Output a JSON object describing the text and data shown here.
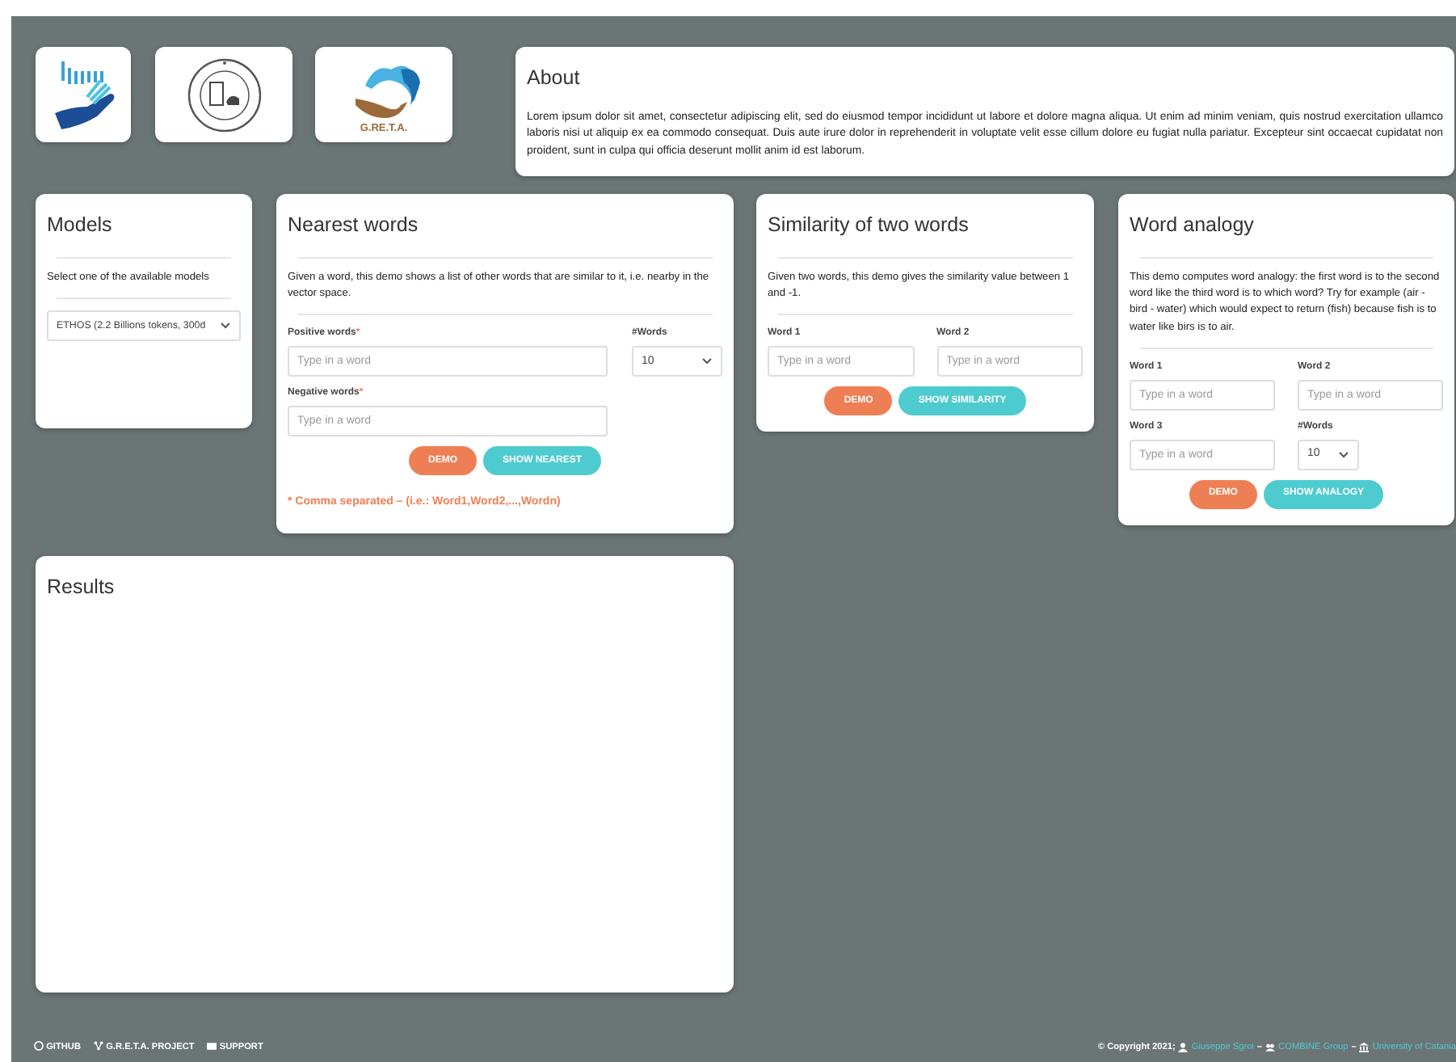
{
  "logos": [
    {
      "kind": "hand"
    },
    {
      "kind": "seal"
    },
    {
      "kind": "greta",
      "caption": "G.RE.T.A."
    }
  ],
  "about": {
    "title": "About",
    "text": "Lorem ipsum dolor sit amet, consectetur adipiscing elit, sed do eiusmod tempor incididunt ut labore et dolore magna aliqua. Ut enim ad minim veniam, quis nostrud exercitation ullamco laboris nisi ut aliquip ex ea commodo consequat. Duis aute irure dolor in reprehenderit in voluptate velit esse cillum dolore eu fugiat nulla pariatur. Excepteur sint occaecat cupidatat non proident, sunt in culpa qui officia deserunt mollit anim id est laborum."
  },
  "models": {
    "title": "Models",
    "text": "Select one of the available models",
    "select": "ETHOS (2.2 Billions tokens, 300d"
  },
  "panels": [
    {
      "title": "Nearest words",
      "text": "Given a word, this demo shows a list of other words that are similar to it, i.e. nearby in the vector space.",
      "rows": [
        [
          {
            "kind": "input",
            "label": "Positive words",
            "marker": "*",
            "placeholder": "Type in a word"
          },
          {
            "kind": "select",
            "label": "#Words",
            "value": "10"
          }
        ],
        [
          {
            "kind": "input",
            "label": "Negative words",
            "marker": "*",
            "placeholder": "Type in a word"
          }
        ]
      ],
      "buttons": [
        {
          "label": "DEMO",
          "kind": "demo"
        },
        {
          "label": "SHOW NEAREST",
          "kind": "show"
        }
      ],
      "note": "* Comma separated – (i.e.: Word1,Word2,...,Wordn)"
    },
    {
      "title": "Similarity of two words",
      "text": "Given two words, this demo gives the similarity value between 1 and -1.",
      "rows": [
        [
          {
            "kind": "input",
            "label": "Word 1",
            "placeholder": "Type in a word"
          },
          {
            "kind": "input",
            "label": "Word 2",
            "placeholder": "Type in a word"
          }
        ]
      ],
      "buttons": [
        {
          "label": "DEMO",
          "kind": "demo"
        },
        {
          "label": "SHOW SIMILARITY",
          "kind": "show"
        }
      ]
    },
    {
      "title": "Word analogy",
      "text": "This demo computes word analogy: the first word is to the second word like the third word is to which word? Try for example (air - bird - water) which would expect to return (fish) because fish is to water like birs is to air.",
      "rows": [
        [
          {
            "kind": "input",
            "label": "Word 1",
            "placeholder": "Type in a word"
          },
          {
            "kind": "input",
            "label": "Word 2",
            "placeholder": "Type in a word"
          }
        ],
        [
          {
            "kind": "input",
            "label": "Word 3",
            "placeholder": "Type in a word"
          },
          {
            "kind": "select",
            "label": "#Words",
            "value": "10"
          }
        ]
      ],
      "buttons": [
        {
          "label": "DEMO",
          "kind": "demo"
        },
        {
          "label": "SHOW ANALOGY",
          "kind": "show"
        }
      ]
    }
  ],
  "results": {
    "title": "Results"
  },
  "footer": {
    "links": [
      {
        "label": "GITHUB"
      },
      {
        "label": "G.R.E.T.A. PROJECT"
      },
      {
        "label": "SUPPORT"
      }
    ],
    "copyright": "© Copyright 2021;",
    "credits": [
      {
        "label": "Giuseppe Sgroi"
      },
      {
        "label": "COMBINE Group"
      },
      {
        "label": "University of Catania"
      }
    ],
    "separator": "–"
  }
}
